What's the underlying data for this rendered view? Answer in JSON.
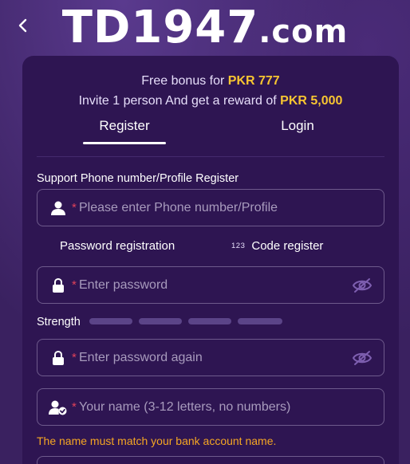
{
  "header": {
    "logo_main": "TD1947",
    "logo_domain": ".com",
    "back_icon": "chevron-left-icon"
  },
  "promo": {
    "line1_text": "Free bonus for ",
    "line1_highlight": "PKR 777",
    "line2_text": "Invite 1 person And get a reward of ",
    "line2_highlight": "PKR 5,000"
  },
  "tabs": [
    {
      "label": "Register",
      "active": true
    },
    {
      "label": "Login",
      "active": false
    }
  ],
  "form": {
    "phone_label": "Support Phone number/Profile Register",
    "phone_placeholder": "Please enter Phone number/Profile",
    "reg_option_password": "Password registration",
    "reg_option_code_badge": "123",
    "reg_option_code": "Code register",
    "password_placeholder": "Enter password",
    "strength_label": "Strength",
    "password_again_placeholder": "Enter password again",
    "name_placeholder": "Your name (3-12 letters, no numbers)",
    "name_warning": "The name must match your bank account name.",
    "required_mark": "*"
  },
  "colors": {
    "accent": "#f7c531",
    "background": "#3a2160",
    "card": "#2e1552",
    "warning": "#f5a623",
    "required": "#e0425a"
  }
}
